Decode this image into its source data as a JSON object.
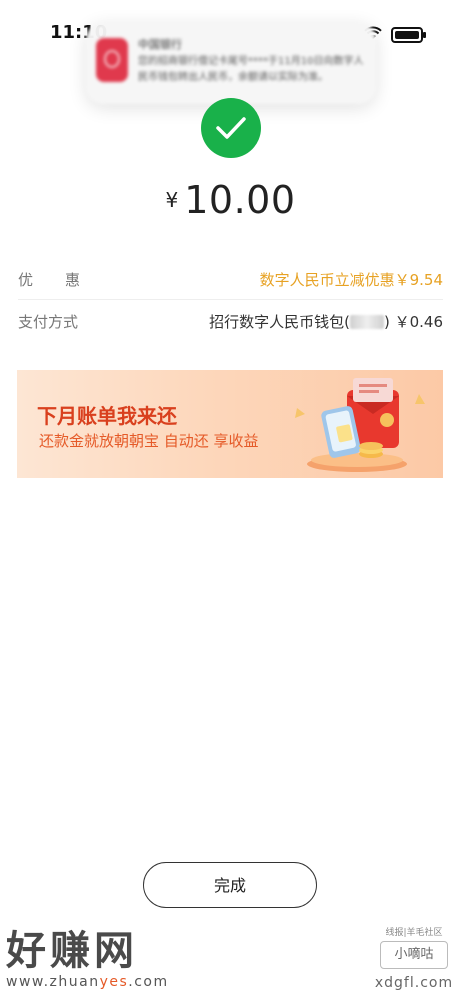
{
  "status_bar": {
    "time": "11:10"
  },
  "notification": {
    "title": "中国银行",
    "body": "您的招商银行借记卡尾号****于11月10日向数字人民币钱包转出人民币，余额请以实际为准。"
  },
  "payment": {
    "currency_symbol": "¥",
    "amount": "10.00"
  },
  "details": {
    "discount_label": "优惠",
    "discount_value": "数字人民币立减优惠￥9.54",
    "payment_label": "支付方式",
    "payment_method_prefix": "招行数字人民币钱包(",
    "payment_method_suffix": ")",
    "payment_amount": "￥0.46"
  },
  "banner": {
    "title": "下月账单我来还",
    "subtitle": "还款金就放朝朝宝 自动还 享收益"
  },
  "done_button": {
    "label": "完成"
  },
  "watermark": {
    "left_big": "好赚网",
    "left_url_1": "www.zhuan",
    "left_url_2": "yes",
    "left_url_3": ".com",
    "right_small": "线报|羊毛社区",
    "right_box": "小嘀咕",
    "right_domain": "xdgfl.com"
  },
  "colors": {
    "success": "#19b14a",
    "discount": "#e7a224",
    "banner_title": "#d9401e"
  }
}
